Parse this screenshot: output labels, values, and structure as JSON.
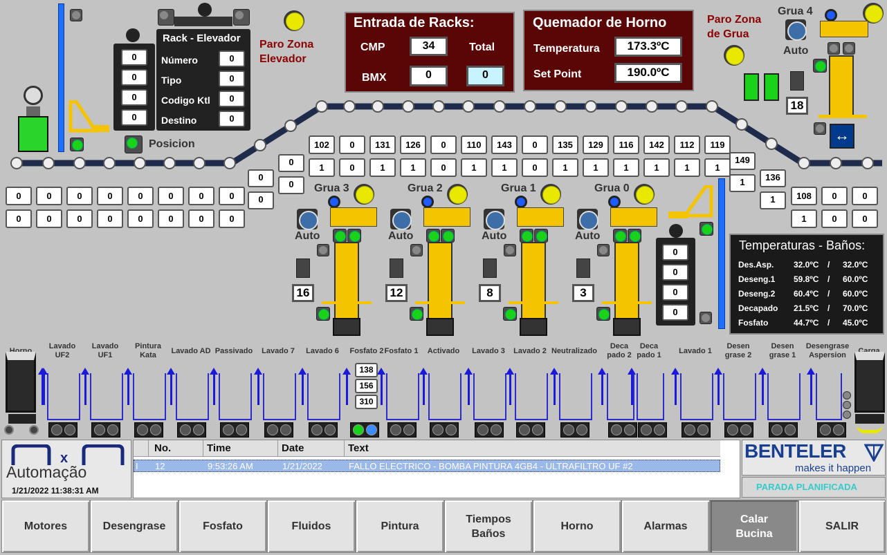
{
  "rack_elevador": {
    "title": "Rack - Elevador",
    "fields": [
      {
        "label": "Número",
        "value": "0"
      },
      {
        "label": "Tipo",
        "value": "0"
      },
      {
        "label": "Codigo Ktl",
        "value": "0"
      },
      {
        "label": "Destino",
        "value": "0"
      }
    ],
    "left_values": [
      "0",
      "0",
      "0",
      "0"
    ],
    "posicion_label": "Posicion"
  },
  "paro_zona_elevador": {
    "line1": "Paro Zona",
    "line2": "Elevador"
  },
  "paro_zona_grua": {
    "line1": "Paro Zona",
    "line2": "de Grua"
  },
  "entrada_racks": {
    "title": "Entrada de Racks:",
    "cmp_label": "CMP",
    "cmp_value": "34",
    "total_label": "Total",
    "bmx_label": "BMX",
    "bmx_value": "0",
    "total_value": "0"
  },
  "quemador": {
    "title": "Quemador de Horno",
    "temp_label": "Temperatura",
    "temp_value": "173.3ºC",
    "sp_label": "Set Point",
    "sp_value": "190.0ºC"
  },
  "grua4": {
    "title": "Grua 4",
    "mode": "Auto",
    "count": "18"
  },
  "gruas": [
    {
      "title": "Grua 3",
      "mode": "Auto",
      "count": "16"
    },
    {
      "title": "Grua 2",
      "mode": "Auto",
      "count": "12"
    },
    {
      "title": "Grua 1",
      "mode": "Auto",
      "count": "8"
    },
    {
      "title": "Grua 0",
      "mode": "Auto",
      "count": "3"
    }
  ],
  "conveyor_top": {
    "top": [
      "102",
      "0",
      "131",
      "126",
      "0",
      "110",
      "143",
      "0",
      "135",
      "129",
      "116",
      "142",
      "112",
      "119"
    ],
    "bottom": [
      "1",
      "0",
      "1",
      "1",
      "0",
      "1",
      "1",
      "0",
      "1",
      "1",
      "1",
      "1",
      "1",
      "1"
    ]
  },
  "conveyor_left": {
    "top": [
      "0",
      "0",
      "0",
      "0",
      "0",
      "0",
      "0",
      "0"
    ],
    "bottom": [
      "0",
      "0",
      "0",
      "0",
      "0",
      "0",
      "0",
      "0"
    ]
  },
  "incline_left": [
    {
      "top": "0",
      "bottom": "0"
    },
    {
      "top": "0",
      "bottom": "0"
    }
  ],
  "incline_right": [
    {
      "top": "149",
      "bottom": "1"
    },
    {
      "top": "136",
      "bottom": "1"
    }
  ],
  "conveyor_right": {
    "top": [
      "108",
      "0",
      "0"
    ],
    "bottom": [
      "1",
      "0",
      "0"
    ]
  },
  "lift_right_values": [
    "0",
    "0",
    "0",
    "0",
    "0"
  ],
  "temps": {
    "title": "Temperaturas - Baños:",
    "rows": [
      {
        "name": "Des.Asp.",
        "pv": "32.0ºC",
        "sep": "/",
        "sp": "32.0ºC"
      },
      {
        "name": "Deseng.1",
        "pv": "59.8ºC",
        "sep": "/",
        "sp": "60.0ºC"
      },
      {
        "name": "Deseng.2",
        "pv": "60.4ºC",
        "sep": "/",
        "sp": "60.0ºC"
      },
      {
        "name": "Decapado",
        "pv": "21.5ºC",
        "sep": "/",
        "sp": "70.0ºC"
      },
      {
        "name": "Fosfato",
        "pv": "44.7ºC",
        "sep": "/",
        "sp": "45.0ºC"
      }
    ]
  },
  "tanks": [
    {
      "l1": "Horno",
      "l2": ""
    },
    {
      "l1": "Lavado",
      "l2": "UF2"
    },
    {
      "l1": "Lavado",
      "l2": "UF1"
    },
    {
      "l1": "Pintura",
      "l2": "Kata"
    },
    {
      "l1": "Lavado AD",
      "l2": ""
    },
    {
      "l1": "Passivado",
      "l2": ""
    },
    {
      "l1": "Lavado 7",
      "l2": ""
    },
    {
      "l1": "Lavado 6",
      "l2": ""
    },
    {
      "l1": "Fosfato 2",
      "l2": ""
    },
    {
      "l1": "Fosfato 1",
      "l2": ""
    },
    {
      "l1": "Activado",
      "l2": ""
    },
    {
      "l1": "Lavado 3",
      "l2": ""
    },
    {
      "l1": "Lavado 2",
      "l2": ""
    },
    {
      "l1": "Neutralizado",
      "l2": ""
    },
    {
      "l1": "Deca",
      "l2": "pado 2"
    },
    {
      "l1": "Deca",
      "l2": "pado 1"
    },
    {
      "l1": "Lavado 1",
      "l2": ""
    },
    {
      "l1": "Desen",
      "l2": "grase 2"
    },
    {
      "l1": "Desen",
      "l2": "grase 1"
    },
    {
      "l1": "Desengrase",
      "l2": "Aspersion"
    },
    {
      "l1": "Carga",
      "l2": ""
    }
  ],
  "fosfato_values": [
    "138",
    "156",
    "310"
  ],
  "brand": {
    "logo_text": "Automação",
    "datetime": "1/21/2022 11:38:31 AM"
  },
  "alarms": {
    "headers": [
      "No.",
      "Time",
      "Date",
      "Text"
    ],
    "rows": [
      {
        "flag": "I",
        "no": "12",
        "time": "9:53:26 AM",
        "date": "1/21/2022",
        "text": "FALLO ELECTRICO - BOMBA PINTURA 4GB4 - ULTRAFILTRO UF #2"
      }
    ]
  },
  "benteler": {
    "name": "BENTELER",
    "tagline": "makes it happen",
    "status": "PARADA PLANIFICADA",
    "accent": "#1a3f8f",
    "status_color": "#33cccc"
  },
  "nav": [
    {
      "label": "Motores"
    },
    {
      "label": "Desengrase"
    },
    {
      "label": "Fosfato"
    },
    {
      "label": "Fluidos"
    },
    {
      "label": "Pintura"
    },
    {
      "label": "Tiempos Baños"
    },
    {
      "label": "Horno"
    },
    {
      "label": "Alarmas"
    },
    {
      "label": "Calar Bucina"
    },
    {
      "label": "SALIR"
    }
  ]
}
